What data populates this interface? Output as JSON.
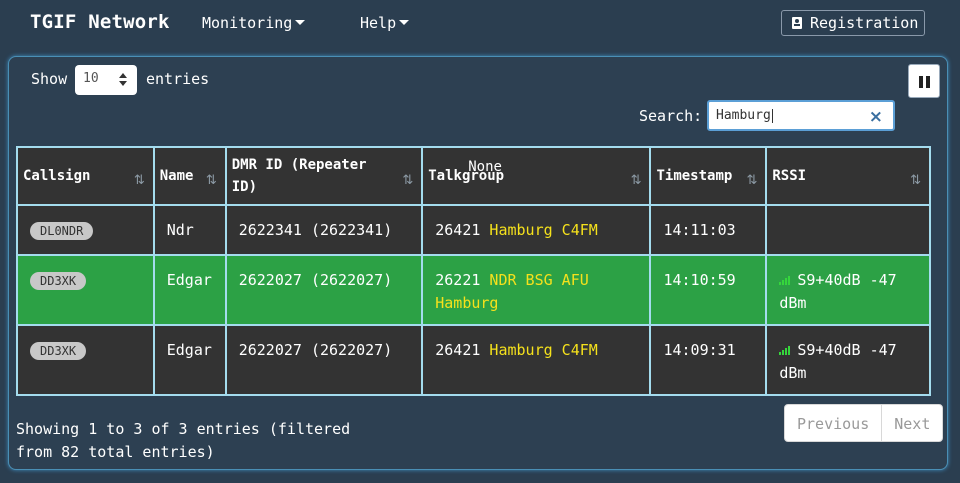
{
  "navbar": {
    "brand": "TGIF Network",
    "monitoring_label": "Monitoring",
    "help_label": "Help",
    "registration_label": "Registration"
  },
  "controls": {
    "show_label": "Show",
    "length_value": "10",
    "entries_label": "entries",
    "search_label": "Search:",
    "search_value": "Hamburg"
  },
  "table": {
    "headers": {
      "callsign": "Callsign",
      "name": "Name",
      "dmr_id": "DMR ID (Repeater ID)",
      "talkgroup": "Talkgroup",
      "talkgroup_extra": "None",
      "timestamp": "Timestamp",
      "rssi": "RSSI"
    },
    "rows": [
      {
        "callsign": "DL0NDR",
        "name": "Ndr",
        "dmr_id": "2622341 (2622341)",
        "tg_number": "26421",
        "tg_name": "Hamburg C4FM",
        "timestamp": "14:11:03",
        "rssi": "",
        "highlight": false
      },
      {
        "callsign": "DD3XK",
        "name": "Edgar",
        "dmr_id": "2622027 (2622027)",
        "tg_number": "26221",
        "tg_name": "NDR BSG AFU Hamburg",
        "timestamp": "14:10:59",
        "rssi": "S9+40dB -47 dBm",
        "highlight": true
      },
      {
        "callsign": "DD3XK",
        "name": "Edgar",
        "dmr_id": "2622027 (2622027)",
        "tg_number": "26421",
        "tg_name": "Hamburg C4FM",
        "timestamp": "14:09:31",
        "rssi": "S9+40dB -47 dBm",
        "highlight": false
      }
    ]
  },
  "footer": {
    "info_text": "Showing 1 to 3 of 3 entries (filtered from 82 total entries)",
    "previous_label": "Previous",
    "next_label": "Next"
  },
  "colors": {
    "background": "#2b3e50",
    "highlight_row": "#2ca145",
    "talkgroup_name": "#f5e11c",
    "table_border": "#a4dcee"
  },
  "icons": [
    "id-badge-icon",
    "caret-down-icon",
    "pause-icon",
    "clear-icon",
    "sort-icon",
    "signal-icon"
  ]
}
